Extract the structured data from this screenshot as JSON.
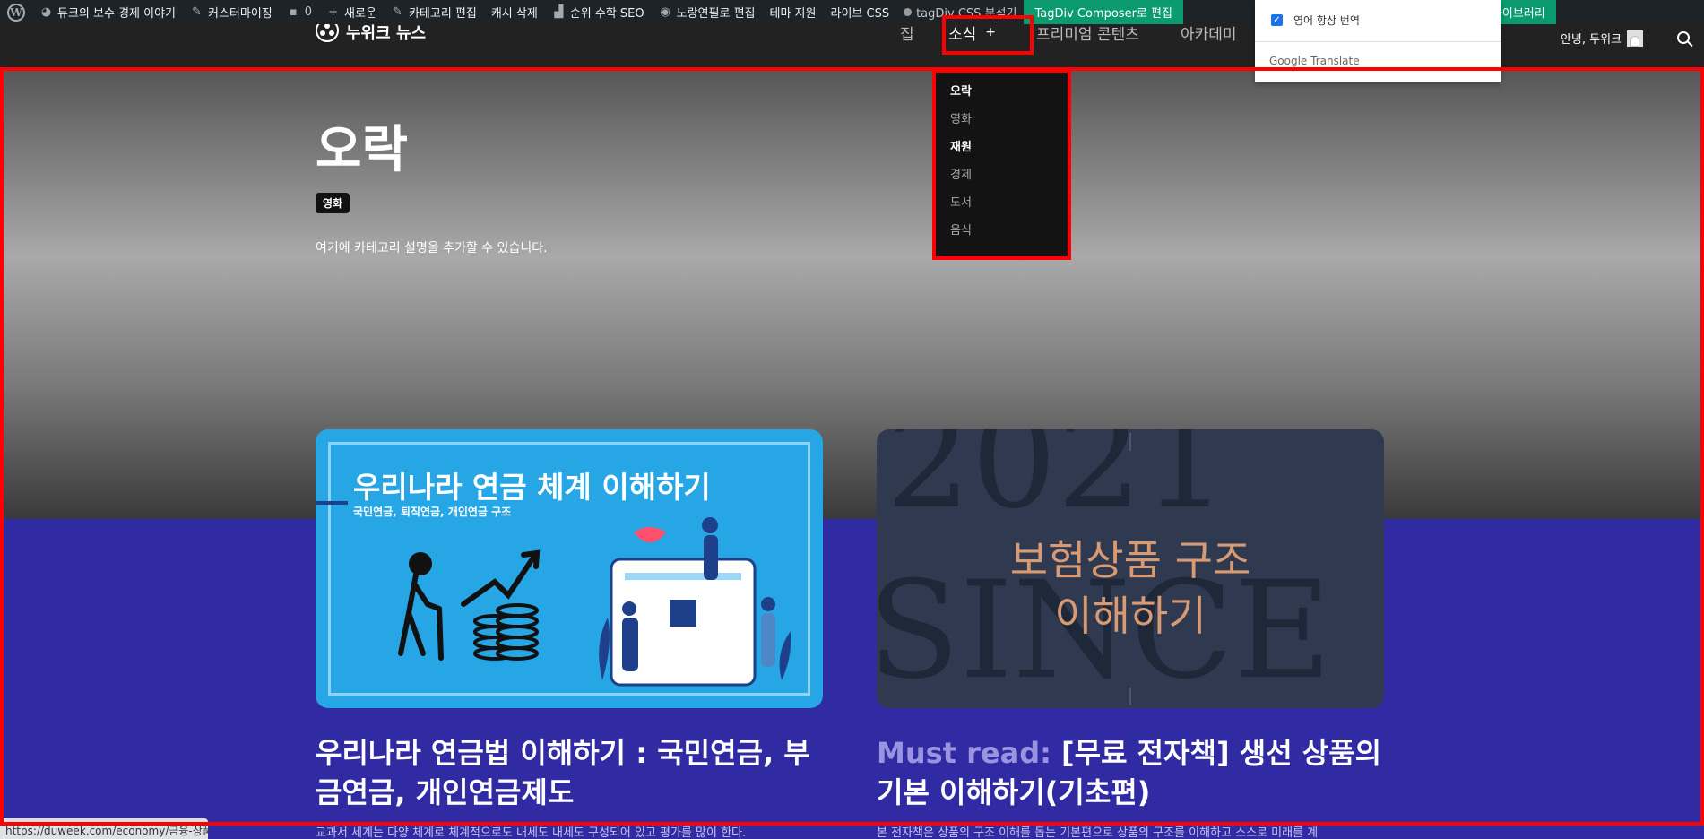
{
  "adminbar": {
    "site_name": "듀크의 보수 경제 이야기",
    "customize": "커스터마이징",
    "comments_count": "0",
    "new": "새로운",
    "edit_category": "카테고리 편집",
    "clear_cache": "캐시 삭제",
    "rank_math": "순위 수학 SEO",
    "edit_with": "노랑연필로 편집",
    "theme_support": "테마 지원",
    "live_css": "라이브 CSS",
    "css_analyzer": "tagDiv CSS 분석기",
    "composer_edit": "TagDiv Composer로 편집",
    "cloud_library": "클라우드 라이브러리"
  },
  "header": {
    "logo_text": "누위크 뉴스",
    "nav": {
      "home_partial": "집",
      "news": "소식",
      "premium": "프리미엄 콘텐츠",
      "academy": "아카데미"
    },
    "greeting": "안녕, 두위크"
  },
  "dropdown": {
    "items": [
      "오락",
      "영화",
      "재원",
      "경제",
      "도서",
      "음식"
    ]
  },
  "translate_popup": {
    "option": "영어 항상 번역",
    "brand": "Google Translate"
  },
  "category": {
    "title": "오락",
    "tag": "영화",
    "description": "여기에 카테고리 설명을 추가할 수 있습니다."
  },
  "posts": [
    {
      "image_title": "우리나라 연금 체계 이해하기",
      "image_subtitle": "국민연금, 퇴직연금, 개인연금 구조",
      "title": "우리나라 연금법 이해하기 : 국민연금, 부금연금, 개인연금제도",
      "excerpt": "교과서 세계는 다양 체계로 체계적으로도 내세도 내세도 구성되어 있고 평가를 많이 한다."
    },
    {
      "image_bg_text_1": "2021",
      "image_bg_text_2": "SINCE",
      "image_title_line1": "보험상품 구조",
      "image_title_line2": "이해하기",
      "prefix": "Must read:",
      "title": "[무료 전자책] 생선 상품의 기본 이해하기(기초편)",
      "excerpt": "본 전자책은 상품의 구조 이해를 돕는 기본편으로 상품의 구조를 이해하고 스스로 미래를 계"
    }
  ],
  "status_url": "https://duweek.com/economy/금융-상품/"
}
